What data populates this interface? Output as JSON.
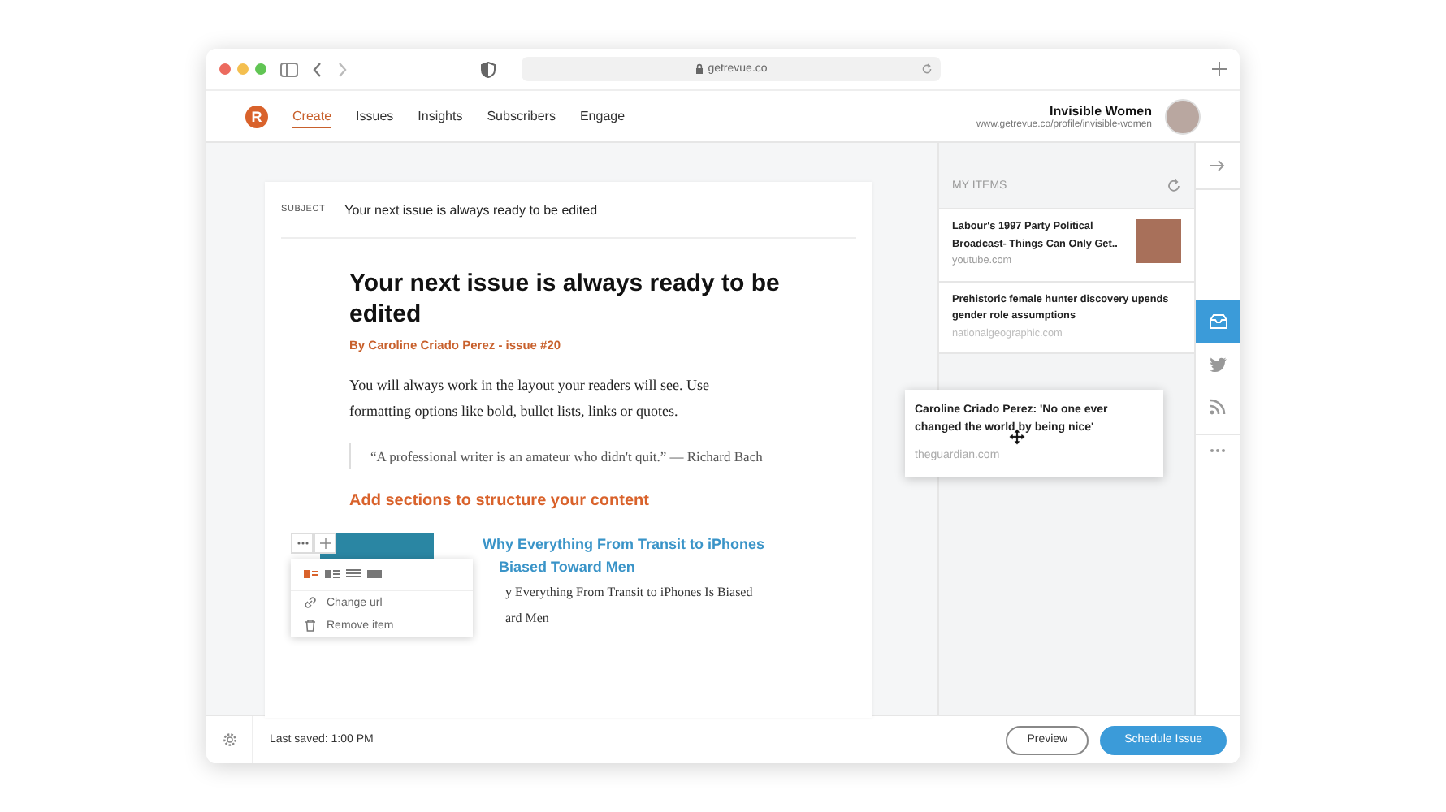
{
  "browser": {
    "url": "getrevue.co"
  },
  "nav": {
    "logo": "R",
    "items": [
      {
        "label": "Create",
        "selected": true
      },
      {
        "label": "Issues",
        "selected": false
      },
      {
        "label": "Insights",
        "selected": false
      },
      {
        "label": "Subscribers",
        "selected": false
      },
      {
        "label": "Engage",
        "selected": false
      }
    ],
    "profile": {
      "name": "Invisible Women",
      "url": "www.getrevue.co/profile/invisible-women"
    }
  },
  "editor": {
    "subject_label": "SUBJECT",
    "subject": "Your next issue is always ready to be edited",
    "title": "Your next issue is always ready to be edited",
    "byline": "By Caroline Criado Perez - issue #20",
    "body": "You will always work in the layout your readers will see. Use formatting options like bold, bullet lists, links or quotes.",
    "quote": "“A professional writer is an amateur who didn't quit.” — Richard Bach",
    "section_heading": "Add sections to structure your content",
    "link_item": {
      "title_lines": [
        "Why Everything From Transit to iPhones",
        "Biased Toward Men"
      ],
      "description_lines": [
        "y Everything From Transit to iPhones Is Biased",
        "ard Men"
      ],
      "menu": {
        "layouts": [
          {
            "selected": true
          },
          {
            "selected": false
          },
          {
            "selected": false
          },
          {
            "selected": false
          }
        ],
        "actions": [
          {
            "label": "Change url",
            "kind": "link"
          },
          {
            "label": "Remove item",
            "kind": "trash"
          }
        ]
      }
    }
  },
  "sidebar": {
    "heading": "MY ITEMS",
    "items": [
      {
        "title": "Labour's 1997 Party Political Broadcast- Things Can Only Get..",
        "source": "youtube.com",
        "thumbnail": true
      },
      {
        "title": "Prehistoric female hunter discovery upends gender role assumptions",
        "source": "nationalgeographic.com",
        "thumbnail": false
      }
    ],
    "dragged_item": {
      "title": "Caroline Criado Perez: 'No one ever changed the world by being nice'",
      "source": "theguardian.com"
    },
    "rail": [
      {
        "kind": "inbox",
        "selected": true
      },
      {
        "kind": "twitter",
        "selected": false
      },
      {
        "kind": "rss",
        "selected": false
      }
    ]
  },
  "footer": {
    "status": "Last saved: 1:00 PM",
    "buttons": [
      {
        "label": "Preview",
        "kind": "secondary"
      },
      {
        "label": "Schedule Issue",
        "kind": "primary"
      }
    ]
  }
}
